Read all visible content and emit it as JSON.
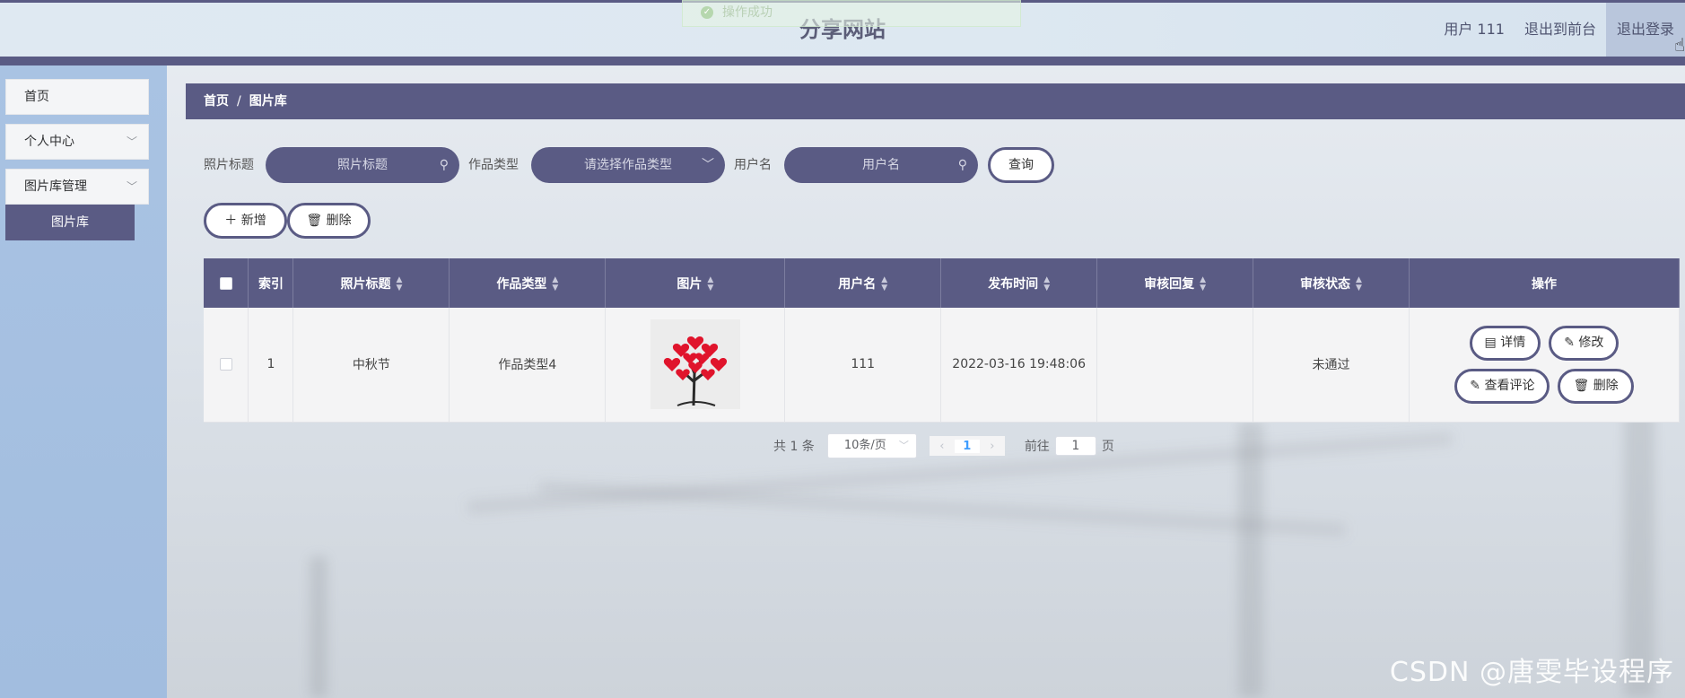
{
  "toast": {
    "message": "操作成功"
  },
  "header": {
    "title": "分享网站",
    "user_label": "用户 111",
    "back_front_label": "退出到前台",
    "logout_label": "退出登录"
  },
  "sidebar": {
    "items": [
      {
        "label": "首页"
      },
      {
        "label": "个人中心"
      },
      {
        "label": "图片库管理"
      }
    ],
    "sub_item": {
      "label": "图片库"
    }
  },
  "breadcrumb": {
    "home": "首页",
    "current": "图片库"
  },
  "search": {
    "title_label": "照片标题",
    "title_placeholder": "照片标题",
    "type_label": "作品类型",
    "type_placeholder": "请选择作品类型",
    "user_label": "用户名",
    "user_placeholder": "用户名",
    "query_button": "查询"
  },
  "actions": {
    "add_label": "新增",
    "delete_label": "删除"
  },
  "table": {
    "columns": [
      "索引",
      "照片标题",
      "作品类型",
      "图片",
      "用户名",
      "发布时间",
      "审核回复",
      "审核状态",
      "操作"
    ],
    "rows": [
      {
        "index": "1",
        "title": "中秋节",
        "type": "作品类型4",
        "user": "111",
        "time": "2022-03-16 19:48:06",
        "reply": "",
        "status": "未通过",
        "ops": {
          "detail": "详情",
          "edit": "修改",
          "comments": "查看评论",
          "delete": "删除"
        }
      }
    ]
  },
  "pagination": {
    "total_text": "共 1 条",
    "page_size": "10条/页",
    "current_page": "1",
    "goto_label": "前往",
    "goto_value": "1",
    "page_unit": "页"
  },
  "watermark": "CSDN @唐雯毕设程序",
  "colors": {
    "primary": "#5a5b84",
    "sidebar": "#a9c3e3",
    "header": "#dfe9f2"
  }
}
